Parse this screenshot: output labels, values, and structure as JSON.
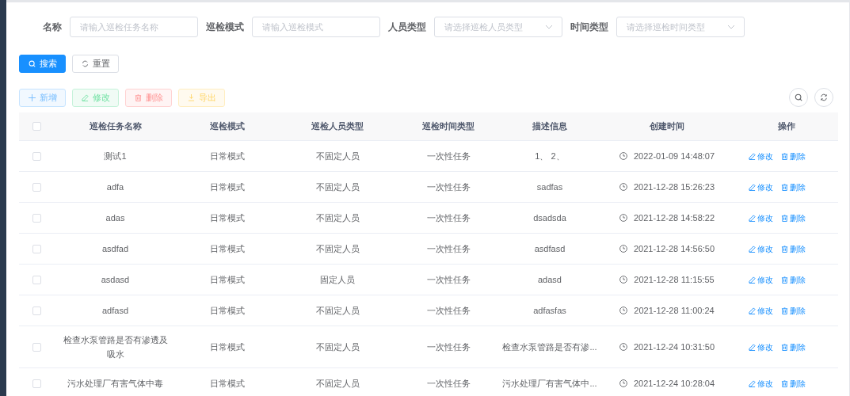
{
  "filters": [
    {
      "label": "名称",
      "placeholder": "请输入巡检任务名称",
      "kind": "input"
    },
    {
      "label": "巡检模式",
      "placeholder": "请输入巡检模式",
      "kind": "input"
    },
    {
      "label": "人员类型",
      "placeholder": "请选择巡检人员类型",
      "kind": "select"
    },
    {
      "label": "时间类型",
      "placeholder": "请选择巡检时间类型",
      "kind": "select"
    }
  ],
  "search_buttons": [
    {
      "label": "搜索",
      "kind": "search"
    },
    {
      "label": "重置",
      "kind": "reset"
    }
  ],
  "actions": [
    {
      "label": "新增",
      "kind": "add"
    },
    {
      "label": "修改",
      "kind": "edit"
    },
    {
      "label": "删除",
      "kind": "delete"
    },
    {
      "label": "导出",
      "kind": "export"
    }
  ],
  "table": {
    "all_selected": false,
    "columns": [
      "巡检任务名称",
      "巡检模式",
      "巡检人员类型",
      "巡检时间类型",
      "描述信息",
      "创建时间",
      "操作"
    ],
    "rows": [
      {
        "selected": false,
        "cells": [
          "测试1",
          "日常模式",
          "不固定人员",
          "一次性任务",
          "1、 2、",
          "2022-01-09 14:48:07"
        ],
        "actions": [
          "修改",
          "删除"
        ]
      },
      {
        "selected": false,
        "cells": [
          "adfa",
          "日常模式",
          "不固定人员",
          "一次性任务",
          "sadfas",
          "2021-12-28 15:26:23"
        ],
        "actions": [
          "修改",
          "删除"
        ]
      },
      {
        "selected": false,
        "cells": [
          "adas",
          "日常模式",
          "不固定人员",
          "一次性任务",
          "dsadsda",
          "2021-12-28 14:58:22"
        ],
        "actions": [
          "修改",
          "删除"
        ]
      },
      {
        "selected": false,
        "cells": [
          "asdfad",
          "日常模式",
          "不固定人员",
          "一次性任务",
          "asdfasd",
          "2021-12-28 14:56:50"
        ],
        "actions": [
          "修改",
          "删除"
        ]
      },
      {
        "selected": false,
        "cells": [
          "asdasd",
          "日常模式",
          "固定人员",
          "一次性任务",
          "adasd",
          "2021-12-28 11:15:55"
        ],
        "actions": [
          "修改",
          "删除"
        ]
      },
      {
        "selected": false,
        "cells": [
          "adfasd",
          "日常模式",
          "不固定人员",
          "一次性任务",
          "adfasfas",
          "2021-12-28 11:00:24"
        ],
        "actions": [
          "修改",
          "删除"
        ]
      },
      {
        "selected": false,
        "cells": [
          "检查水泵管路是否有渗透及吸水",
          "日常模式",
          "不固定人员",
          "一次性任务",
          "检查水泵管路是否有渗...",
          "2021-12-24 10:31:50"
        ],
        "actions": [
          "修改",
          "删除"
        ]
      },
      {
        "selected": false,
        "cells": [
          "污水处理厂有害气体中毒",
          "日常模式",
          "不固定人员",
          "一次性任务",
          "污水处理厂有害气体中...",
          "2021-12-24 10:28:04"
        ],
        "actions": [
          "修改",
          "删除"
        ]
      }
    ]
  }
}
